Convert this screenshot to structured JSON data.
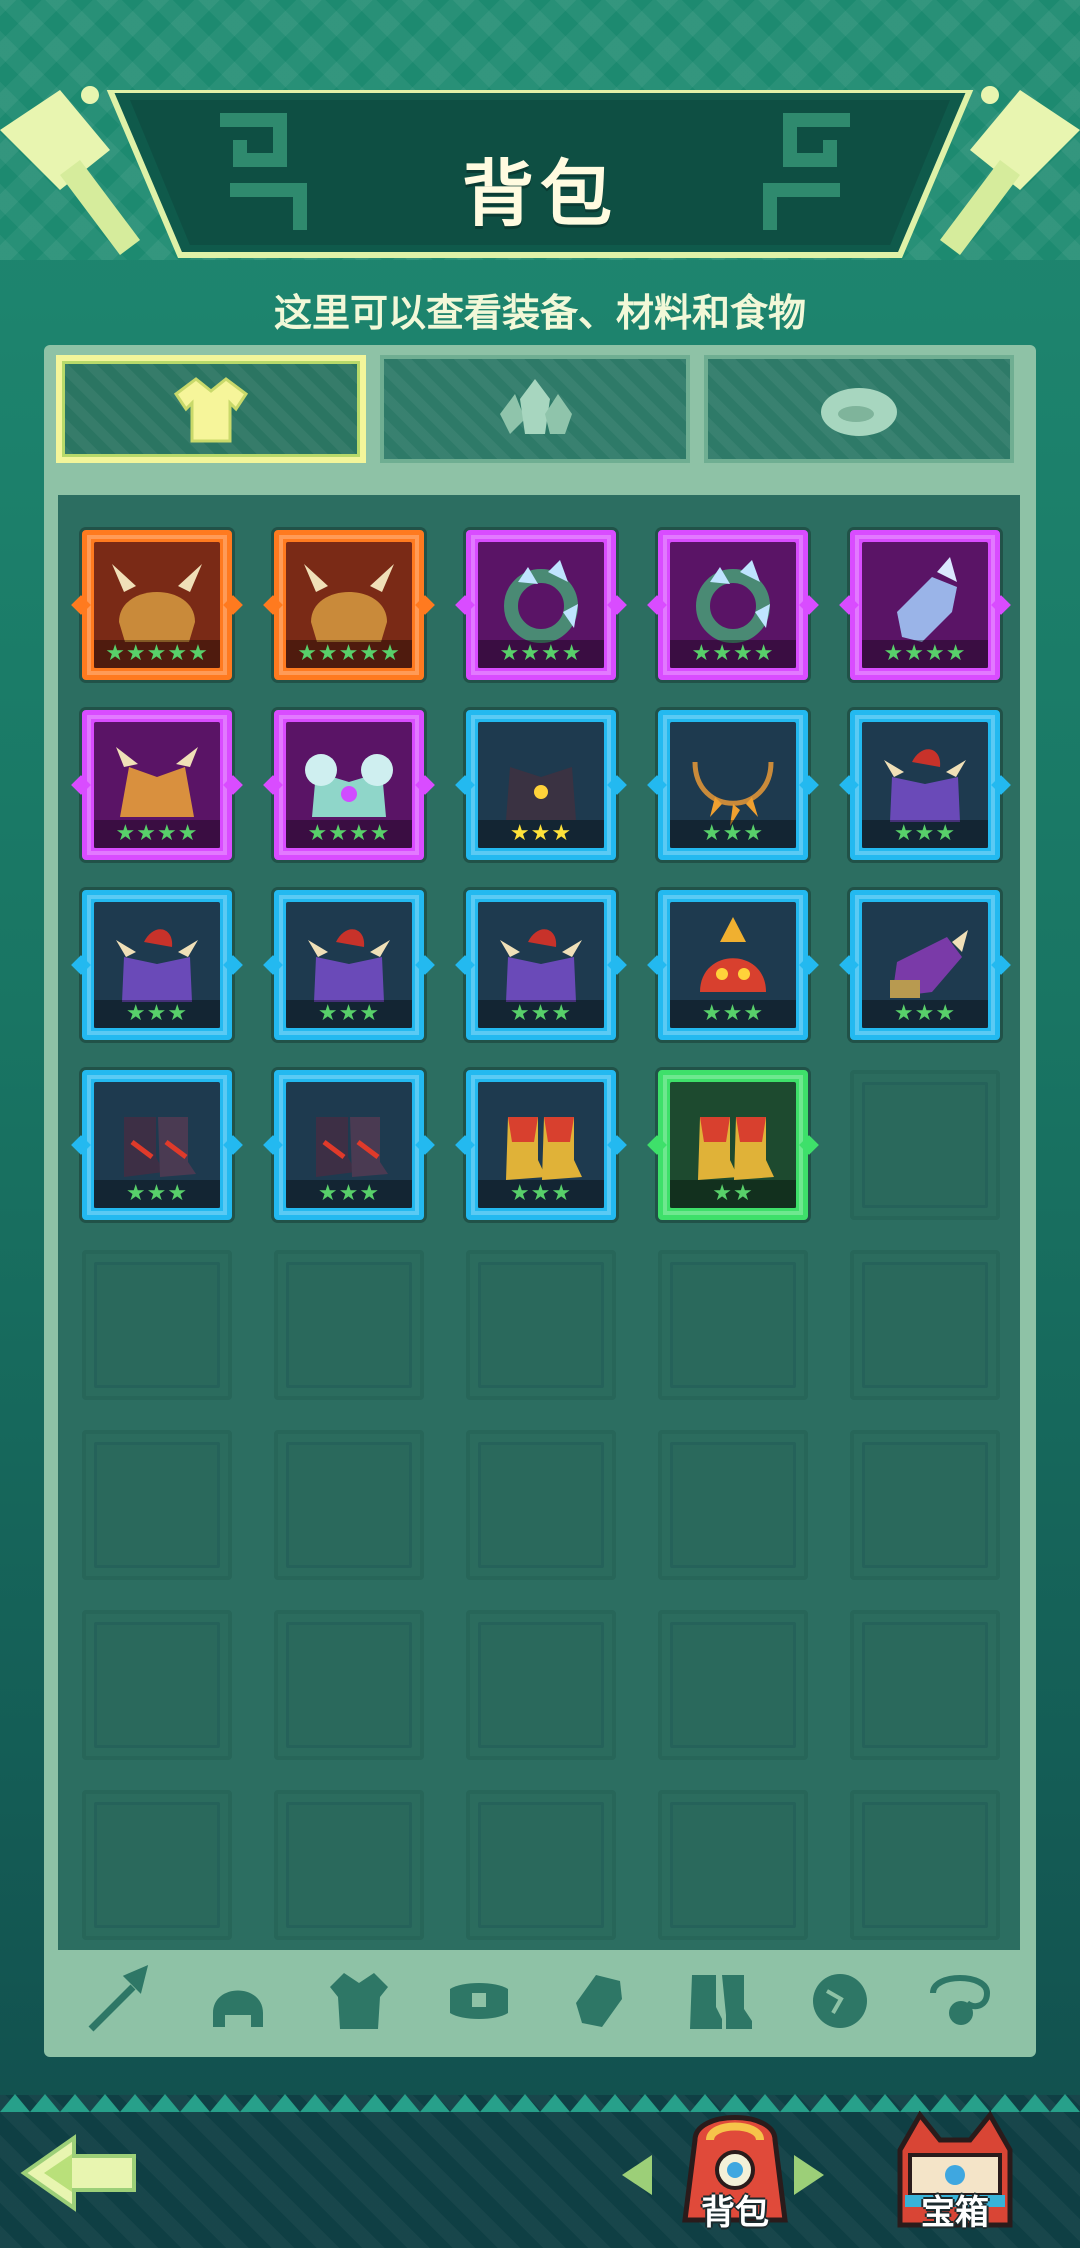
{
  "header": {
    "title": "背包",
    "subtitle": "这里可以查看装备、材料和食物"
  },
  "tabs": [
    {
      "name": "equipment",
      "icon": "armor-icon",
      "active": true
    },
    {
      "name": "materials",
      "icon": "crystal-icon",
      "active": false
    },
    {
      "name": "food",
      "icon": "meat-icon",
      "active": false
    }
  ],
  "inventory": [
    {
      "rarity": "orange",
      "icon": "horned-helmet-icon",
      "stars": "★★★★★"
    },
    {
      "rarity": "orange",
      "icon": "horned-helmet-icon",
      "stars": "★★★★★"
    },
    {
      "rarity": "purple",
      "icon": "crystal-ring-icon",
      "stars": "★★★★"
    },
    {
      "rarity": "purple",
      "icon": "crystal-ring-icon",
      "stars": "★★★★"
    },
    {
      "rarity": "purple",
      "icon": "crystal-bracer-icon",
      "stars": "★★★★"
    },
    {
      "rarity": "purple",
      "icon": "bone-chestplate-icon",
      "stars": "★★★★"
    },
    {
      "rarity": "purple",
      "icon": "frost-chestplate-icon",
      "stars": "★★★★"
    },
    {
      "rarity": "blue",
      "icon": "dark-chestplate-icon",
      "stars": "★★★"
    },
    {
      "rarity": "blue",
      "icon": "fang-necklace-icon",
      "stars": "★★★"
    },
    {
      "rarity": "blue",
      "icon": "beast-chestplate-icon",
      "stars": "★★★"
    },
    {
      "rarity": "blue",
      "icon": "beast-chestplate-icon",
      "stars": "★★★"
    },
    {
      "rarity": "blue",
      "icon": "beast-chestplate-icon",
      "stars": "★★★"
    },
    {
      "rarity": "blue",
      "icon": "beast-chestplate-icon",
      "stars": "★★★"
    },
    {
      "rarity": "blue",
      "icon": "dragon-helmet-icon",
      "stars": "★★★"
    },
    {
      "rarity": "blue",
      "icon": "horn-bracer-icon",
      "stars": "★★★"
    },
    {
      "rarity": "blue",
      "icon": "dark-boots-icon",
      "stars": "★★★"
    },
    {
      "rarity": "blue",
      "icon": "dark-boots-icon",
      "stars": "★★★"
    },
    {
      "rarity": "blue",
      "icon": "flame-boots-icon",
      "stars": "★★★"
    },
    {
      "rarity": "green",
      "icon": "flame-boots-icon",
      "stars": "★★"
    }
  ],
  "categories": [
    {
      "icon": "spear-icon"
    },
    {
      "icon": "helmet-icon"
    },
    {
      "icon": "armor-icon"
    },
    {
      "icon": "belt-icon"
    },
    {
      "icon": "bracer-icon"
    },
    {
      "icon": "boots-icon"
    },
    {
      "icon": "orb-icon"
    },
    {
      "icon": "necklace-icon"
    }
  ],
  "bottom_nav": {
    "back_icon": "back-arrow-icon",
    "bag_label": "背包",
    "chest_label": "宝箱"
  },
  "colors": {
    "orange": "#ff7a1f",
    "purple": "#d94cff",
    "blue": "#23b9f0",
    "green": "#3ee06a",
    "star_green": "#58d06a",
    "star_yellow": "#ffe23a"
  }
}
